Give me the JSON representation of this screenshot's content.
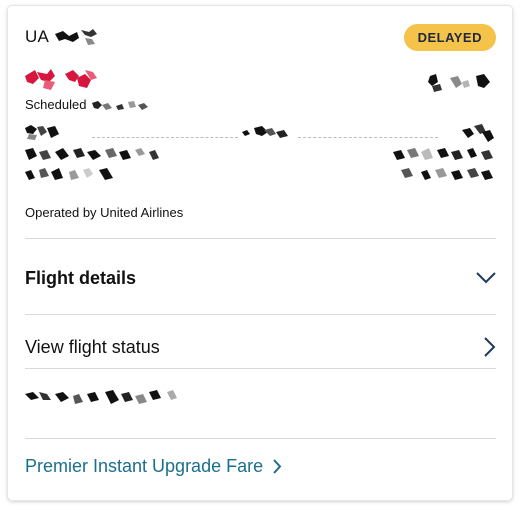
{
  "header": {
    "carrier_code": "UA",
    "status_badge": "DELAYED"
  },
  "schedule": {
    "scheduled_label": "Scheduled"
  },
  "operated_by": "Operated by United Airlines",
  "flight_details": {
    "label": "Flight details",
    "icon": "chevron-down-icon"
  },
  "flight_status": {
    "label": "View flight status",
    "icon": "chevron-right-icon"
  },
  "upgrade": {
    "label": "Premier Instant Upgrade Fare",
    "icon": "chevron-right-icon"
  },
  "colors": {
    "badge_bg": "#f5c24a",
    "link": "#1a6f8e",
    "delayed_time": "#d6163f",
    "divider": "#d9d9d9"
  }
}
